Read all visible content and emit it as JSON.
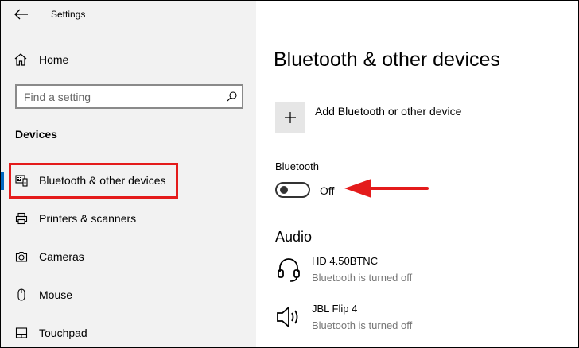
{
  "app": {
    "title": "Settings"
  },
  "sidebar": {
    "home_label": "Home",
    "search_placeholder": "Find a setting",
    "section_title": "Devices",
    "items": [
      {
        "label": "Bluetooth & other devices",
        "icon": "bluetooth-devices-icon",
        "active": true
      },
      {
        "label": "Printers & scanners",
        "icon": "printer-icon"
      },
      {
        "label": "Cameras",
        "icon": "camera-icon"
      },
      {
        "label": "Mouse",
        "icon": "mouse-icon"
      },
      {
        "label": "Touchpad",
        "icon": "touchpad-icon"
      }
    ]
  },
  "main": {
    "title": "Bluetooth & other devices",
    "add_device_label": "Add Bluetooth or other device",
    "bluetooth_label": "Bluetooth",
    "bluetooth_state": "Off",
    "audio_title": "Audio",
    "devices": [
      {
        "name": "HD 4.50BTNC",
        "status": "Bluetooth is turned off",
        "icon": "headset-icon"
      },
      {
        "name": "JBL Flip 4",
        "status": "Bluetooth is turned off",
        "icon": "speaker-icon"
      }
    ]
  },
  "colors": {
    "accent": "#0067c0",
    "annotation": "#e41b1b",
    "sidebar_bg": "#f2f2f2",
    "muted_text": "#767676"
  }
}
